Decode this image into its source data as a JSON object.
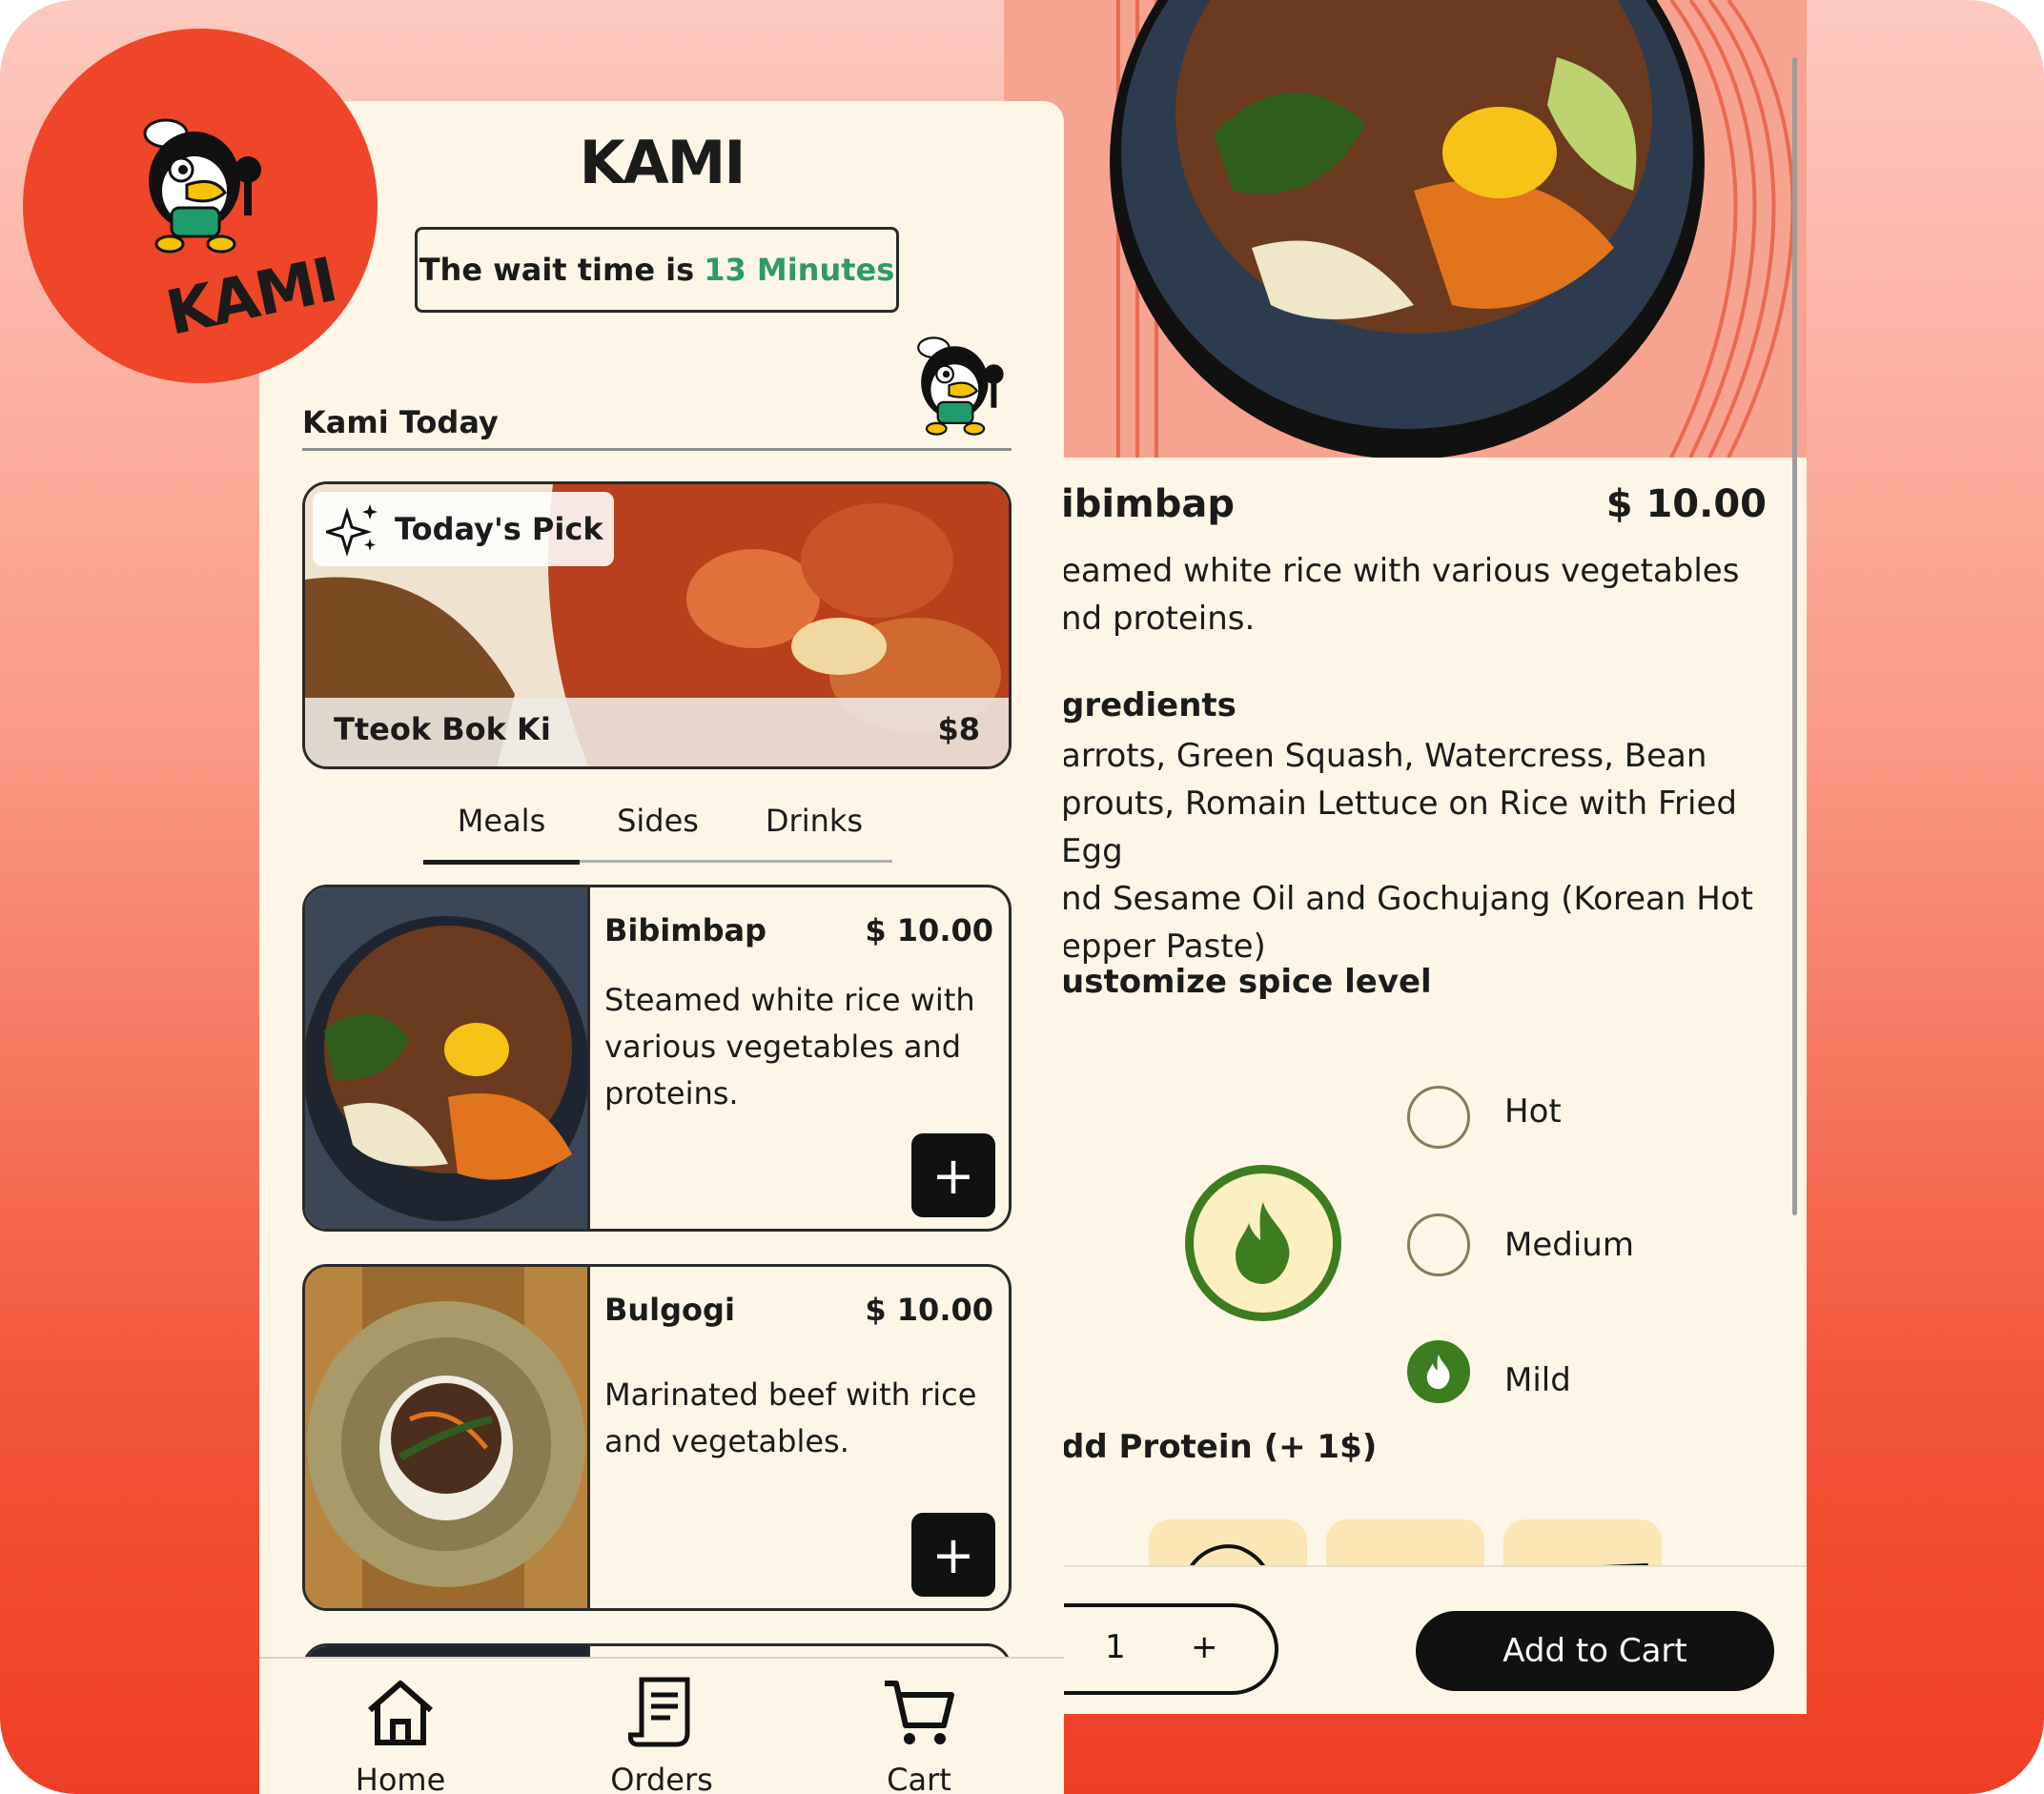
{
  "brand": {
    "name": "KAMI"
  },
  "header": {
    "logo": "KAMI",
    "wait_prefix": "The wait time is",
    "wait_value": "13 Minutes"
  },
  "today": {
    "heading": "Kami Today",
    "badge": "Today's Pick",
    "item_name": "Tteok Bok Ki",
    "item_price": "$8"
  },
  "tabs": [
    {
      "label": "Meals",
      "active": true
    },
    {
      "label": "Sides",
      "active": false
    },
    {
      "label": "Drinks",
      "active": false
    }
  ],
  "meals": [
    {
      "name": "Bibimbap",
      "price": "$ 10.00",
      "description": "Steamed white rice with various vegetables and proteins.",
      "add_label": "+"
    },
    {
      "name": "Bulgogi",
      "price": "$ 10.00",
      "description": "Marinated beef with rice and vegetables.",
      "add_label": "+"
    }
  ],
  "nav": [
    {
      "label": "Home",
      "icon": "home-icon"
    },
    {
      "label": "Orders",
      "icon": "receipt-icon"
    },
    {
      "label": "Cart",
      "icon": "cart-icon"
    }
  ],
  "detail": {
    "name": "ibimbap",
    "price": "$ 10.00",
    "description": "eamed white rice with various vegetables\nnd proteins.",
    "ingredients_heading": "gredients",
    "ingredients": "arrots, Green Squash, Watercress, Bean\nprouts, Romain Lettuce on Rice with Fried Egg\nnd Sesame Oil and Gochujang (Korean Hot\nepper Paste)",
    "spice_heading": "ustomize spice level",
    "spice_options": [
      {
        "label": "Hot",
        "selected": false
      },
      {
        "label": "Medium",
        "selected": false
      },
      {
        "label": "Mild",
        "selected": true
      }
    ],
    "protein_heading": "dd Protein (+ 1$)",
    "quantity": "1",
    "minus": "-",
    "plus": "+",
    "add_to_cart": "Add to Cart"
  },
  "colors": {
    "accent_red": "#ef4528",
    "wait_green": "#2f9a63",
    "spice_green": "#3c7d1f",
    "cream": "#fdf6e6"
  }
}
